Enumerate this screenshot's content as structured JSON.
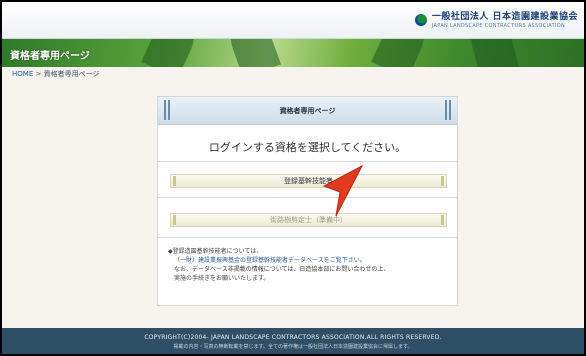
{
  "header": {
    "org_name_ja": "一般社団法人 日本造園建設業協会",
    "org_name_en": "JAPAN LANDSCAPE CONTRACTORS ASSOCIATION"
  },
  "banner": {
    "title": "資格者専用ページ"
  },
  "breadcrumb": {
    "home": "HOME",
    "separator": ">",
    "current": "資格者専用ページ"
  },
  "panel": {
    "title": "資格者専用ページ",
    "prompt": "ログインする資格を選択してください。",
    "buttons": [
      {
        "label": "登録基幹技能者",
        "disabled": false
      },
      {
        "label": "街路樹剪定士（準備中）",
        "disabled": true
      }
    ],
    "notes": {
      "heading": "◆登録造園基幹技能者については、",
      "link": "（一財）建設業振興基金の登録基幹技能者データベースをご覧下さい。",
      "line1": "なお、データベース非掲載の情報については、日造協本部にお問い合わせの上、",
      "line2": "実施の手続きをお願いいたします。"
    }
  },
  "footer": {
    "copyright": "COPYRIGHT(C)2004- JAPAN LANDSCAPE CONTRACTORS ASSOCIATION.ALL RIGHTS RESERVED.",
    "notice": "掲載の内容・写真の無断転載を禁じます。全ての著作権は一般社団法人日本造園建設業協会に帰属します。"
  },
  "colors": {
    "banner_green": "#5aa43a",
    "footer_bg": "#2f4f67",
    "panel_head": "#cfdde9",
    "cursor_red": "#e23a1e"
  }
}
